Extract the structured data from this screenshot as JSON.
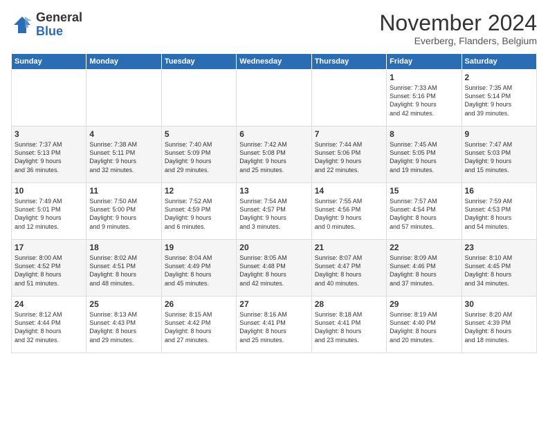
{
  "logo": {
    "general": "General",
    "blue": "Blue"
  },
  "title": "November 2024",
  "subtitle": "Everberg, Flanders, Belgium",
  "days_of_week": [
    "Sunday",
    "Monday",
    "Tuesday",
    "Wednesday",
    "Thursday",
    "Friday",
    "Saturday"
  ],
  "weeks": [
    [
      {
        "day": "",
        "info": ""
      },
      {
        "day": "",
        "info": ""
      },
      {
        "day": "",
        "info": ""
      },
      {
        "day": "",
        "info": ""
      },
      {
        "day": "",
        "info": ""
      },
      {
        "day": "1",
        "info": "Sunrise: 7:33 AM\nSunset: 5:16 PM\nDaylight: 9 hours\nand 42 minutes."
      },
      {
        "day": "2",
        "info": "Sunrise: 7:35 AM\nSunset: 5:14 PM\nDaylight: 9 hours\nand 39 minutes."
      }
    ],
    [
      {
        "day": "3",
        "info": "Sunrise: 7:37 AM\nSunset: 5:13 PM\nDaylight: 9 hours\nand 36 minutes."
      },
      {
        "day": "4",
        "info": "Sunrise: 7:38 AM\nSunset: 5:11 PM\nDaylight: 9 hours\nand 32 minutes."
      },
      {
        "day": "5",
        "info": "Sunrise: 7:40 AM\nSunset: 5:09 PM\nDaylight: 9 hours\nand 29 minutes."
      },
      {
        "day": "6",
        "info": "Sunrise: 7:42 AM\nSunset: 5:08 PM\nDaylight: 9 hours\nand 25 minutes."
      },
      {
        "day": "7",
        "info": "Sunrise: 7:44 AM\nSunset: 5:06 PM\nDaylight: 9 hours\nand 22 minutes."
      },
      {
        "day": "8",
        "info": "Sunrise: 7:45 AM\nSunset: 5:05 PM\nDaylight: 9 hours\nand 19 minutes."
      },
      {
        "day": "9",
        "info": "Sunrise: 7:47 AM\nSunset: 5:03 PM\nDaylight: 9 hours\nand 15 minutes."
      }
    ],
    [
      {
        "day": "10",
        "info": "Sunrise: 7:49 AM\nSunset: 5:01 PM\nDaylight: 9 hours\nand 12 minutes."
      },
      {
        "day": "11",
        "info": "Sunrise: 7:50 AM\nSunset: 5:00 PM\nDaylight: 9 hours\nand 9 minutes."
      },
      {
        "day": "12",
        "info": "Sunrise: 7:52 AM\nSunset: 4:59 PM\nDaylight: 9 hours\nand 6 minutes."
      },
      {
        "day": "13",
        "info": "Sunrise: 7:54 AM\nSunset: 4:57 PM\nDaylight: 9 hours\nand 3 minutes."
      },
      {
        "day": "14",
        "info": "Sunrise: 7:55 AM\nSunset: 4:56 PM\nDaylight: 9 hours\nand 0 minutes."
      },
      {
        "day": "15",
        "info": "Sunrise: 7:57 AM\nSunset: 4:54 PM\nDaylight: 8 hours\nand 57 minutes."
      },
      {
        "day": "16",
        "info": "Sunrise: 7:59 AM\nSunset: 4:53 PM\nDaylight: 8 hours\nand 54 minutes."
      }
    ],
    [
      {
        "day": "17",
        "info": "Sunrise: 8:00 AM\nSunset: 4:52 PM\nDaylight: 8 hours\nand 51 minutes."
      },
      {
        "day": "18",
        "info": "Sunrise: 8:02 AM\nSunset: 4:51 PM\nDaylight: 8 hours\nand 48 minutes."
      },
      {
        "day": "19",
        "info": "Sunrise: 8:04 AM\nSunset: 4:49 PM\nDaylight: 8 hours\nand 45 minutes."
      },
      {
        "day": "20",
        "info": "Sunrise: 8:05 AM\nSunset: 4:48 PM\nDaylight: 8 hours\nand 42 minutes."
      },
      {
        "day": "21",
        "info": "Sunrise: 8:07 AM\nSunset: 4:47 PM\nDaylight: 8 hours\nand 40 minutes."
      },
      {
        "day": "22",
        "info": "Sunrise: 8:09 AM\nSunset: 4:46 PM\nDaylight: 8 hours\nand 37 minutes."
      },
      {
        "day": "23",
        "info": "Sunrise: 8:10 AM\nSunset: 4:45 PM\nDaylight: 8 hours\nand 34 minutes."
      }
    ],
    [
      {
        "day": "24",
        "info": "Sunrise: 8:12 AM\nSunset: 4:44 PM\nDaylight: 8 hours\nand 32 minutes."
      },
      {
        "day": "25",
        "info": "Sunrise: 8:13 AM\nSunset: 4:43 PM\nDaylight: 8 hours\nand 29 minutes."
      },
      {
        "day": "26",
        "info": "Sunrise: 8:15 AM\nSunset: 4:42 PM\nDaylight: 8 hours\nand 27 minutes."
      },
      {
        "day": "27",
        "info": "Sunrise: 8:16 AM\nSunset: 4:41 PM\nDaylight: 8 hours\nand 25 minutes."
      },
      {
        "day": "28",
        "info": "Sunrise: 8:18 AM\nSunset: 4:41 PM\nDaylight: 8 hours\nand 23 minutes."
      },
      {
        "day": "29",
        "info": "Sunrise: 8:19 AM\nSunset: 4:40 PM\nDaylight: 8 hours\nand 20 minutes."
      },
      {
        "day": "30",
        "info": "Sunrise: 8:20 AM\nSunset: 4:39 PM\nDaylight: 8 hours\nand 18 minutes."
      }
    ]
  ]
}
